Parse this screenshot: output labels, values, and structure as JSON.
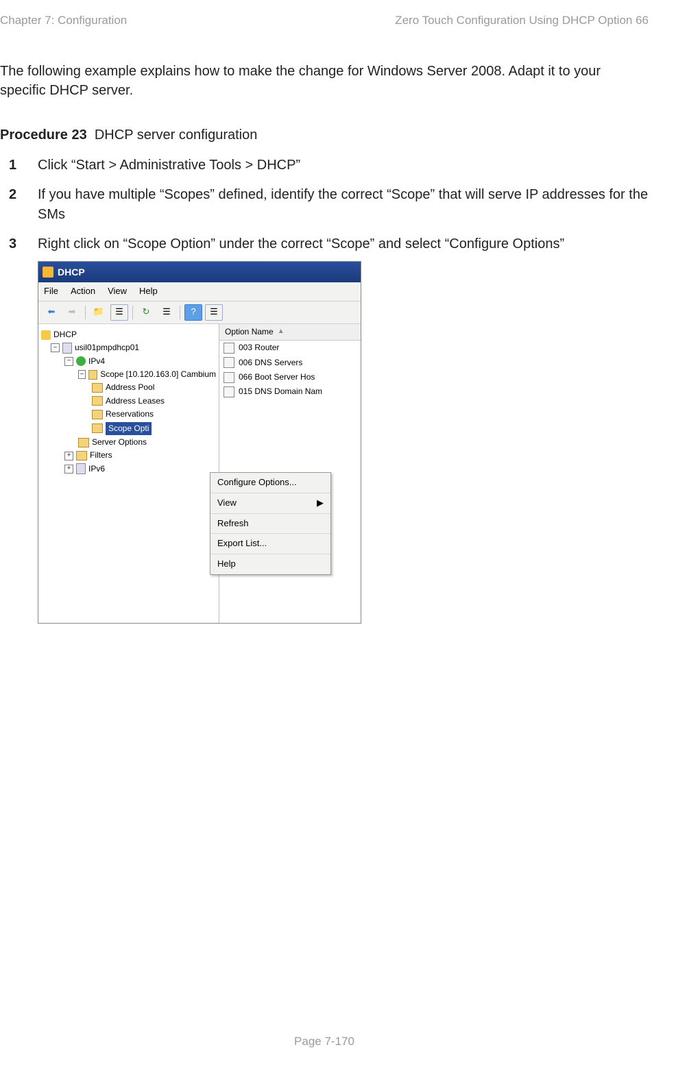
{
  "header": {
    "left": "Chapter 7:  Configuration",
    "right": "Zero Touch Configuration Using DHCP Option 66"
  },
  "intro": "The following example explains how to make the change for Windows Server 2008. Adapt it to your specific DHCP server.",
  "procedure": {
    "label": "Procedure 23",
    "title": "DHCP server configuration",
    "steps": [
      "Click “Start > Administrative Tools > DHCP”",
      "If you have multiple “Scopes” defined, identify the correct “Scope” that will serve IP addresses for the SMs",
      "Right click on “Scope Option” under the correct “Scope” and select “Configure Options”"
    ]
  },
  "screenshot": {
    "title": "DHCP",
    "menus": [
      "File",
      "Action",
      "View",
      "Help"
    ],
    "tree": {
      "root": "DHCP",
      "server": "usil01pmpdhcp01",
      "ipv4": "IPv4",
      "scope": "Scope [10.120.163.0] Cambium",
      "scope_children": [
        "Address Pool",
        "Address Leases",
        "Reservations",
        "Scope Options",
        "Server Options"
      ],
      "selected": "Scope Opti",
      "server_options": "Server Options",
      "filters": "Filters",
      "ipv6": "IPv6"
    },
    "options_header": "Option Name",
    "options": [
      "003 Router",
      "006 DNS Servers",
      "066 Boot Server Hos",
      "015 DNS Domain Nam"
    ],
    "context_menu": [
      "Configure Options...",
      "View",
      "Refresh",
      "Export List...",
      "Help"
    ]
  },
  "footer": "Page 7-170"
}
